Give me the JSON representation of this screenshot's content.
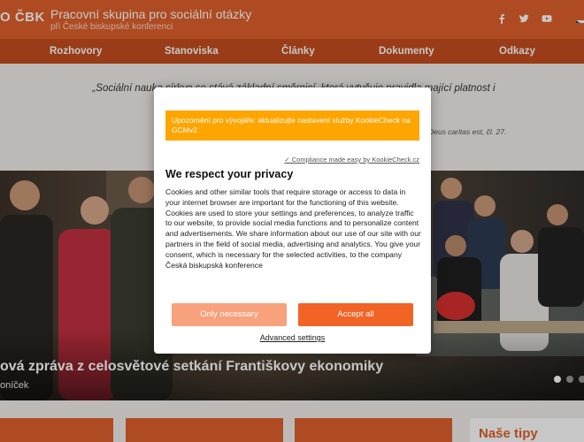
{
  "header": {
    "logo": "O ČBK",
    "title": "Pracovní skupina pro sociální otázky",
    "subtitle": "při České biskupské konferenci",
    "social_icons": [
      "facebook-icon",
      "twitter-icon",
      "youtube-icon"
    ],
    "flag_icon": "czech-flag-icon"
  },
  "nav": {
    "items": [
      {
        "label": "Rozhovory"
      },
      {
        "label": "Stanoviska"
      },
      {
        "label": "Články"
      },
      {
        "label": "Dokumenty"
      },
      {
        "label": "Odkazy"
      }
    ]
  },
  "quote": {
    "text": "„Sociální nauka církve se stává základní směrnicí, která vytyčuje pravidla mající platnost i daleko za jejími v… …racujícího rozvoje promy… …svět. “",
    "source": "Deus caritas est, čl. 27."
  },
  "hero": {
    "title": "ová zpráva z celosvětové setkání Františkovy ekonomiky",
    "author": "oníček",
    "slides": 3,
    "active_slide": 0
  },
  "tips": {
    "title": "Naše tipy"
  },
  "cookie_modal": {
    "dev_warning": "Upozornění pro vývojáře: aktualizujte nastavení služby KookieCheck na GCMv2",
    "compliance_link": "✓ Compliance made easy by KookieCheck.cz",
    "heading": "We respect your privacy",
    "body": "Cookies and other similar tools that require storage or access to data in your internet browser are important for the functioning of this website. Cookies are used to store your settings and preferences, to analyze traffic to our website, to provide social media functions and to personalize content and advertisements. We share information about our use of our site with our partners in the field of social media, advertising and analytics. You give your consent, which is necessary for the selected activities, to the company Česká biskupská konference",
    "btn_necessary": "Only necessary",
    "btn_accept": "Accept all",
    "advanced_link": "Advanced settings"
  },
  "colors": {
    "brand_orange": "#e0612c",
    "nav_orange": "#c54d1e",
    "warning": "#ffa500",
    "accept": "#f26426",
    "necessary": "#f7a27d"
  }
}
